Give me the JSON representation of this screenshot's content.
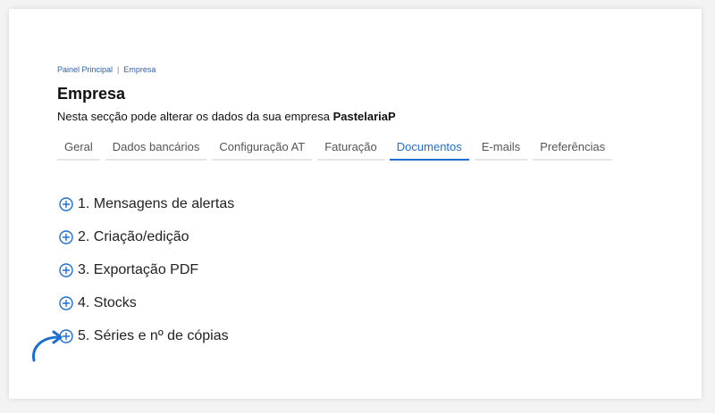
{
  "breadcrumb": {
    "home": "Painel Principal",
    "separator": "|",
    "current": "Empresa"
  },
  "page": {
    "title": "Empresa",
    "subtitle_prefix": "Nesta secção pode alterar os dados da sua empresa",
    "company_name": "PastelariaP"
  },
  "tabs": [
    {
      "label": "Geral"
    },
    {
      "label": "Dados bancários"
    },
    {
      "label": "Configuração AT"
    },
    {
      "label": "Faturação"
    },
    {
      "label": "Documentos",
      "active": true
    },
    {
      "label": "E-mails"
    },
    {
      "label": "Preferências"
    }
  ],
  "sections": [
    {
      "label": "1. Mensagens de alertas",
      "icon": "plus-circle-icon"
    },
    {
      "label": "2. Criação/edição",
      "icon": "plus-circle-icon"
    },
    {
      "label": "3. Exportação PDF",
      "icon": "plus-circle-icon"
    },
    {
      "label": "4. Stocks",
      "icon": "plus-circle-icon"
    },
    {
      "label": "5. Séries e nº de cópias",
      "icon": "plus-circle-icon"
    }
  ],
  "colors": {
    "accent": "#1f6fd1",
    "link": "#2f5fa8",
    "arrow": "#1f6fd1"
  },
  "annotation": {
    "icon": "curved-arrow-icon"
  }
}
